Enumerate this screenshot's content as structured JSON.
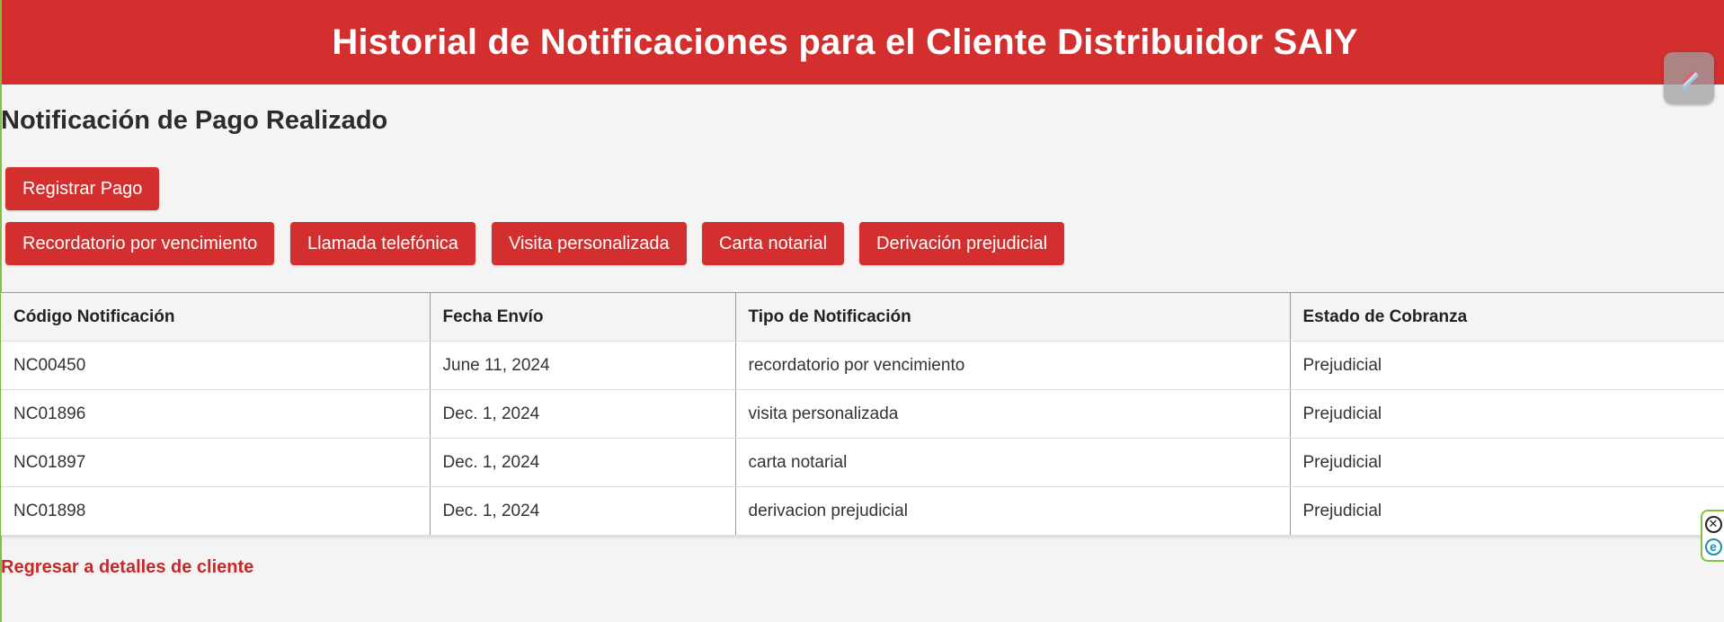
{
  "header": {
    "title": "Historial de Notificaciones para el Cliente Distribuidor SAIY"
  },
  "page_title": "Notificación de Pago Realizado",
  "buttons": {
    "register_payment": "Registrar Pago",
    "actions": [
      "Recordatorio por vencimiento",
      "Llamada telefónica",
      "Visita personalizada",
      "Carta notarial",
      "Derivación prejudicial"
    ]
  },
  "table": {
    "headers": [
      "Código Notificación",
      "Fecha Envío",
      "Tipo de Notificación",
      "Estado de Cobranza"
    ],
    "rows": [
      [
        "NC00450",
        "June 11, 2024",
        "recordatorio por vencimiento",
        "Prejudicial"
      ],
      [
        "NC01896",
        "Dec. 1, 2024",
        "visita personalizada",
        "Prejudicial"
      ],
      [
        "NC01897",
        "Dec. 1, 2024",
        "carta notarial",
        "Prejudicial"
      ],
      [
        "NC01898",
        "Dec. 1, 2024",
        "derivacion prejudicial",
        "Prejudicial"
      ]
    ]
  },
  "back_link": "Regresar a detalles de cliente",
  "colors": {
    "brand_red": "#d32f2f",
    "link_red": "#c62828",
    "background": "#f4f4f4",
    "extension_green": "#7fc241"
  },
  "icons": {
    "corner_widget": "feather-pen-icon",
    "ext_close": "close-circle-icon",
    "ext_logo": "e-logo-icon"
  }
}
